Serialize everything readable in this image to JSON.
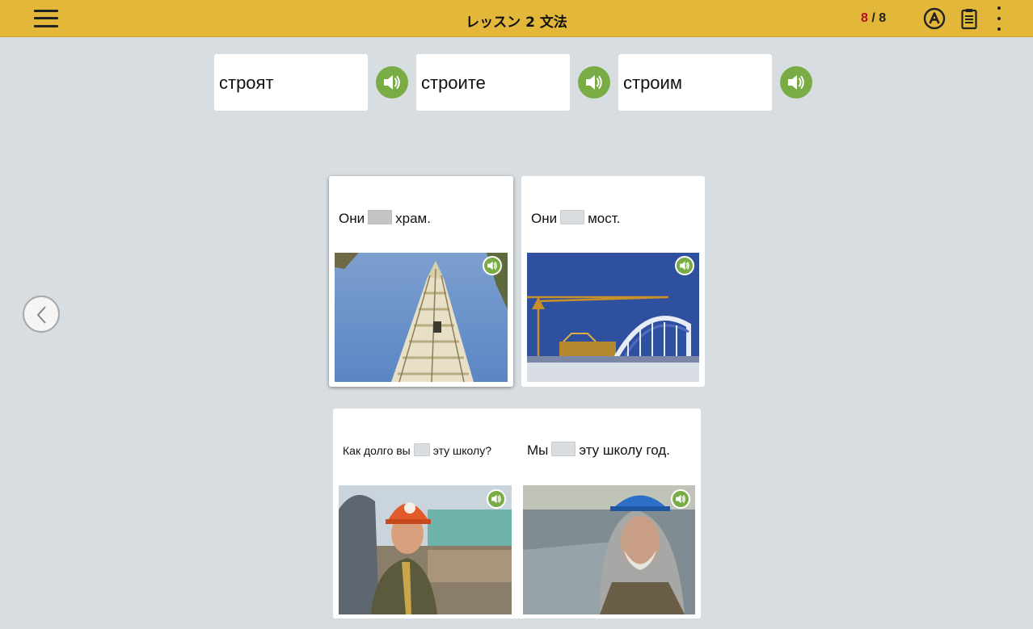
{
  "header": {
    "title": "レッスン 2 文法",
    "progress_current": "8",
    "progress_separator": " / ",
    "progress_total": "8"
  },
  "icons": {
    "menu": "hamburger-menu-icon",
    "answer": "circled-a-icon",
    "notes": "clipboard-icon",
    "more": "vertical-ellipsis-icon",
    "audio": "speaker-icon",
    "prev": "chevron-left-icon"
  },
  "word_bank": [
    {
      "word": "строят"
    },
    {
      "word": "строите"
    },
    {
      "word": "строим"
    }
  ],
  "cards": [
    {
      "before": "Они",
      "after": "храм.",
      "image": "temple-under-construction"
    },
    {
      "before": "Они",
      "after": "мост.",
      "image": "bridge-and-crane"
    },
    {
      "before": "Как долго вы",
      "after": "эту школу?",
      "image": "worker-orange-helmet"
    },
    {
      "before": "Мы",
      "after": "эту школу год.",
      "image": "worker-blue-helmet"
    }
  ],
  "colors": {
    "header_bg": "#e3b83a",
    "page_bg": "#d7dde1",
    "audio_green": "#7aac46",
    "progress_current": "#b3101e"
  }
}
